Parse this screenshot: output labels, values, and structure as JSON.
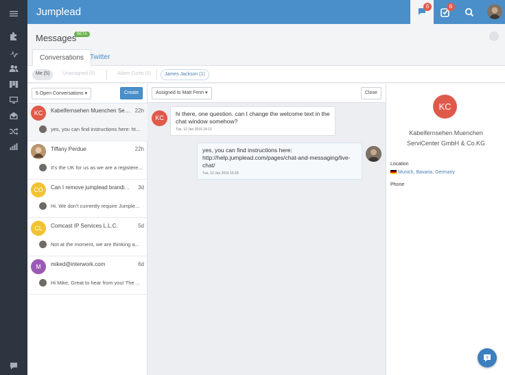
{
  "app": {
    "brand": "Jumplead",
    "chat_badge": "6",
    "tasks_badge": "6"
  },
  "colors": {
    "topbar": "#4a8fc9",
    "nav": "#2d3540",
    "accent": "#4a8fc9"
  },
  "header": {
    "title": "Messages",
    "badge": "BETA"
  },
  "tabs": [
    "Conversations",
    "Twitter"
  ],
  "filters": {
    "me": "Me (5)",
    "unassigned": "Unassigned (0)",
    "adam": "Adam Curtis (0)",
    "james": "James Jackson (1)"
  },
  "list": {
    "dropdown": "5 Open Conversations ▾",
    "create": "Create",
    "items": [
      {
        "initials": "KC",
        "color": "#e05a4b",
        "name": "Kabelfernsehen Muenchen ServiC...",
        "time": "22h",
        "preview": "yes, you can find instructions here: ht..."
      },
      {
        "initials": "",
        "color": "#a08060",
        "name": "Tiffany Perdue",
        "time": "22h",
        "preview": "It's the UK for us as we are a registere..."
      },
      {
        "initials": "CO",
        "color": "#f1c232",
        "name": "Can I remove jumplead branding fr...",
        "time": "3d",
        "preview": "Hi. We don't currently require Jumple..."
      },
      {
        "initials": "CL",
        "color": "#f1c232",
        "name": "Comcast IP Services L.L.C.",
        "time": "5d",
        "preview": "Not at the moment, we are thinking a..."
      },
      {
        "initials": "M",
        "color": "#9b59b6",
        "name": "miked@interwork.com",
        "time": "6d",
        "preview": "Hi Mike, Great to hear from you! The ..."
      }
    ]
  },
  "chat": {
    "assigned": "Assigned to Matt Fenn ▾",
    "close": "Close",
    "messages": [
      {
        "initials": "KC",
        "text": "hi there, one question. can I change the welcome text in the chat window somehow?",
        "stamp": "Tue, 12 Jan 2016 14:13"
      },
      {
        "text": "yes, you can find instructions here: http://help.jumplead.com/pages/chat-and-messaging/live-chat/",
        "stamp": "Tue, 12 Jan 2016 15:18"
      }
    ]
  },
  "detail": {
    "initials": "KC",
    "company": "Kabelfernsehen Muenchen ServiCenter GmbH & Co.KG",
    "location_label": "Location",
    "location_value": "Munich, Bavaria, Germany",
    "phone_label": "Phone"
  }
}
